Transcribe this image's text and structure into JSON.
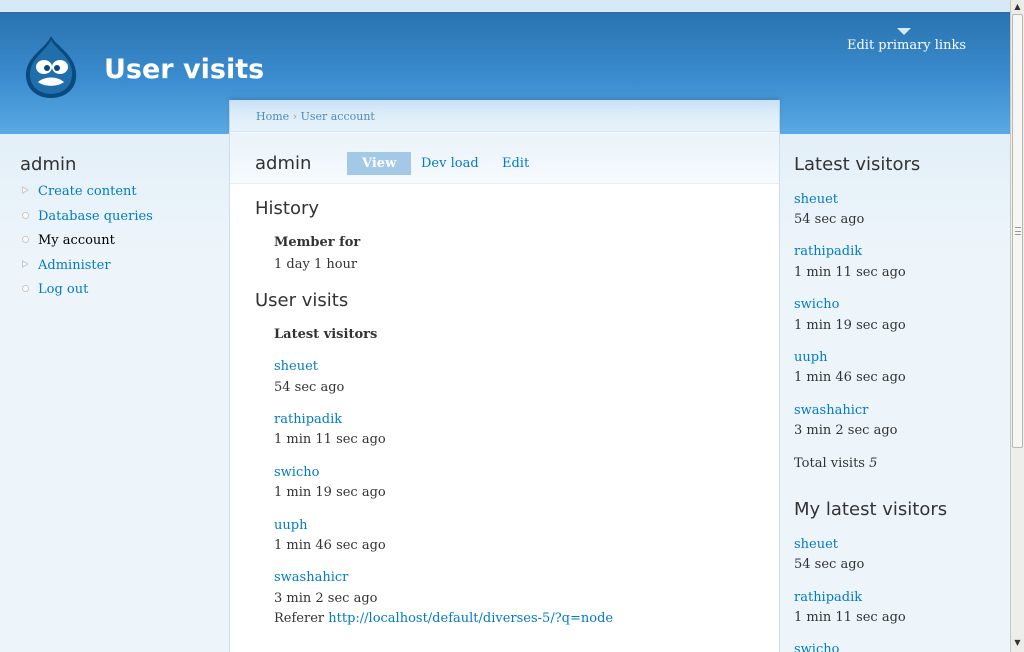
{
  "header": {
    "site_title": "User visits",
    "primary_links_label": "Edit primary links"
  },
  "sidebar_left": {
    "title": "admin",
    "menu": [
      {
        "label": "Create content",
        "icon": "collapsed-triangle-icon"
      },
      {
        "label": "Database queries",
        "icon": "leaf-bullet-icon"
      },
      {
        "label": "My account",
        "icon": "leaf-bullet-icon"
      },
      {
        "label": "Administer",
        "icon": "collapsed-triangle-icon"
      },
      {
        "label": "Log out",
        "icon": "leaf-bullet-icon"
      }
    ]
  },
  "breadcrumb": {
    "items": [
      "Home",
      "User account"
    ],
    "separator": "›"
  },
  "main": {
    "title": "admin",
    "tabs": [
      {
        "label": "View",
        "active": true
      },
      {
        "label": "Dev load",
        "active": false
      },
      {
        "label": "Edit",
        "active": false
      }
    ],
    "history": {
      "heading": "History",
      "member_label": "Member for",
      "member_value": "1 day 1 hour"
    },
    "user_visits": {
      "heading": "User visits",
      "sub_heading": "Latest visitors",
      "visitors": [
        {
          "name": "sheuet",
          "time": "54 sec ago"
        },
        {
          "name": "rathipadik",
          "time": "1 min 11 sec ago"
        },
        {
          "name": "swicho",
          "time": "1 min 19 sec ago"
        },
        {
          "name": "uuph",
          "time": "1 min 46 sec ago"
        },
        {
          "name": "swashahicr",
          "time": "3 min 2 sec ago"
        }
      ],
      "referer_label": "Referer",
      "referer_url": "http://localhost/default/diverses-5/?q=node"
    }
  },
  "sidebar_right": {
    "latest_heading": "Latest visitors",
    "latest": [
      {
        "name": "sheuet",
        "time": "54 sec ago"
      },
      {
        "name": "rathipadik",
        "time": "1 min 11 sec ago"
      },
      {
        "name": "swicho",
        "time": "1 min 19 sec ago"
      },
      {
        "name": "uuph",
        "time": "1 min 46 sec ago"
      },
      {
        "name": "swashahicr",
        "time": "3 min 2 sec ago"
      }
    ],
    "total_label": "Total visits",
    "total_value": "5",
    "my_latest_heading": "My latest visitors",
    "my_latest": [
      {
        "name": "sheuet",
        "time": "54 sec ago"
      },
      {
        "name": "rathipadik",
        "time": "1 min 11 sec ago"
      },
      {
        "name": "swicho",
        "time": ""
      }
    ]
  },
  "colors": {
    "link": "#027ac6",
    "header_top": "#2a73b0",
    "header_bottom": "#5aa9e4",
    "active_tab": "#a3c9e7",
    "sidebar_bg": "#edf5fa"
  }
}
